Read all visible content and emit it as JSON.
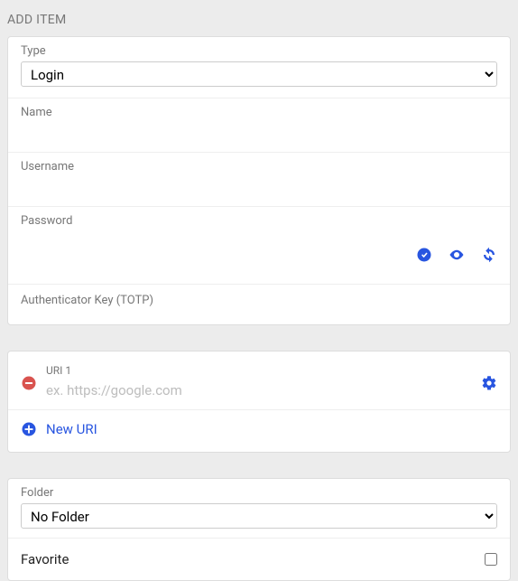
{
  "title": "ADD ITEM",
  "type": {
    "label": "Type",
    "value": "Login"
  },
  "name": {
    "label": "Name",
    "value": ""
  },
  "username": {
    "label": "Username",
    "value": ""
  },
  "password": {
    "label": "Password",
    "value": ""
  },
  "totp": {
    "label": "Authenticator Key (TOTP)",
    "value": ""
  },
  "uri": {
    "items": [
      {
        "label": "URI 1",
        "value": "",
        "placeholder": "ex. https://google.com"
      }
    ],
    "new_label": "New URI"
  },
  "folder": {
    "label": "Folder",
    "value": "No Folder"
  },
  "favorite": {
    "label": "Favorite",
    "checked": false
  }
}
